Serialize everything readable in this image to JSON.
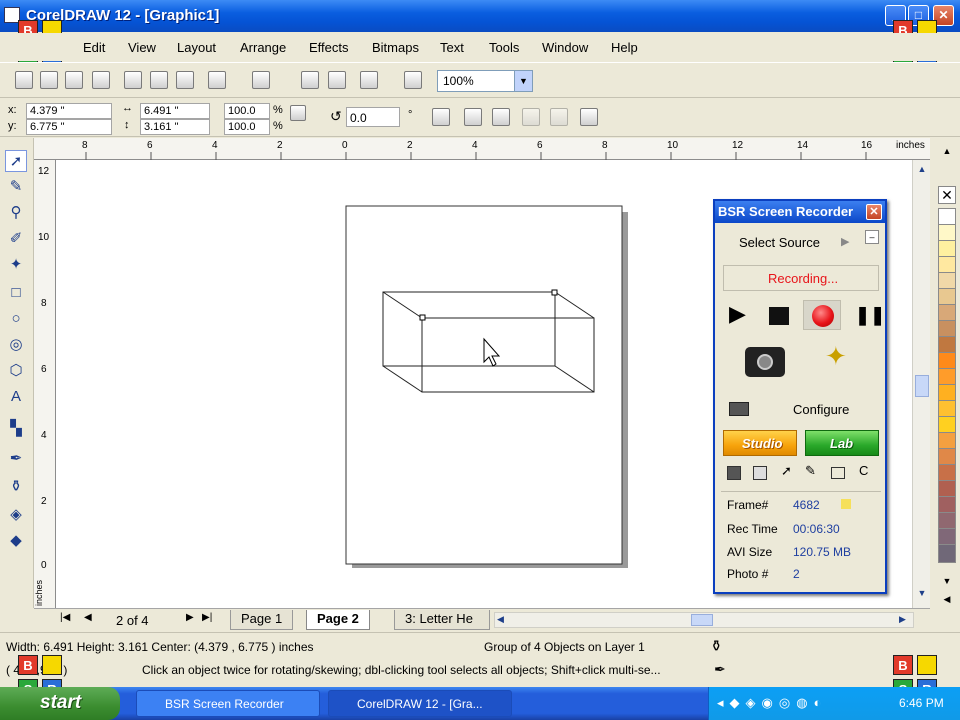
{
  "window": {
    "title": "CorelDRAW 12 - [Graphic1]"
  },
  "menu": [
    "Edit",
    "View",
    "Layout",
    "Arrange",
    "Effects",
    "Bitmaps",
    "Text",
    "Tools",
    "Window",
    "Help"
  ],
  "zoom": {
    "value": "100%"
  },
  "props": {
    "x_label": "x:",
    "x": "4.379 \"",
    "y_label": "y:",
    "y": "6.775 \"",
    "w": "6.491 \"",
    "h": "3.161 \"",
    "scale_w": "100.0",
    "scale_h": "100.0",
    "pct": "%",
    "angle": "0.0",
    "deg": "°"
  },
  "ruler": {
    "unit": "inches",
    "h_ticks": [
      "8",
      "6",
      "4",
      "2",
      "0",
      "2",
      "4",
      "6",
      "8",
      "10",
      "12",
      "14",
      "16"
    ],
    "v_ticks": [
      "12",
      "10",
      "8",
      "6",
      "4",
      "2",
      "0"
    ],
    "v_unit": "inches"
  },
  "pages": {
    "counter": "2 of 4",
    "tabs": [
      "Page 1",
      "Page 2",
      "3: Letter He"
    ],
    "active": 1
  },
  "status": {
    "dims": "Width: 6.491  Height: 3.161  Center: (4.379 , 6.775 )  inches",
    "object": "Group of 4 Objects on Layer 1",
    "coords": "( 4 ... ,901 )",
    "hint": "Click an object twice for rotating/skewing; dbl-clicking tool selects all objects; Shift+click multi-se..."
  },
  "taskbar": {
    "start": "start",
    "tasks": [
      "BSR Screen Recorder",
      "CorelDRAW 12 - [Gra..."
    ],
    "clock": "6:46 PM"
  },
  "bsr": {
    "title": "BSR Screen Recorder",
    "select_source": "Select Source",
    "recording": "Recording...",
    "configure": "Configure",
    "studio": "Studio",
    "lab": "Lab",
    "info": [
      {
        "label": "Frame#",
        "value": "4682"
      },
      {
        "label": "Rec Time",
        "value": "00:06:30"
      },
      {
        "label": "AVI Size",
        "value": "120.75 MB"
      },
      {
        "label": "Photo #",
        "value": "2"
      }
    ]
  },
  "logo_letters": [
    "B",
    "",
    "S",
    "R"
  ],
  "colors": {
    "palette": [
      "#ffffff",
      "#fff8c8",
      "#fff0a0",
      "#ffe8a0",
      "#f0d8a8",
      "#e8c890",
      "#d8a878",
      "#c89060",
      "#c07840",
      "#ff8a1a",
      "#ff9c2a",
      "#ffb020",
      "#ffc030",
      "#ffd020",
      "#f4a040",
      "#e08848",
      "#c87048",
      "#b06050",
      "#a06060",
      "#906870",
      "#806878",
      "#706878"
    ],
    "recording": "#e8141a",
    "studio": "#f7a30c",
    "lab": "#2aa82a"
  }
}
